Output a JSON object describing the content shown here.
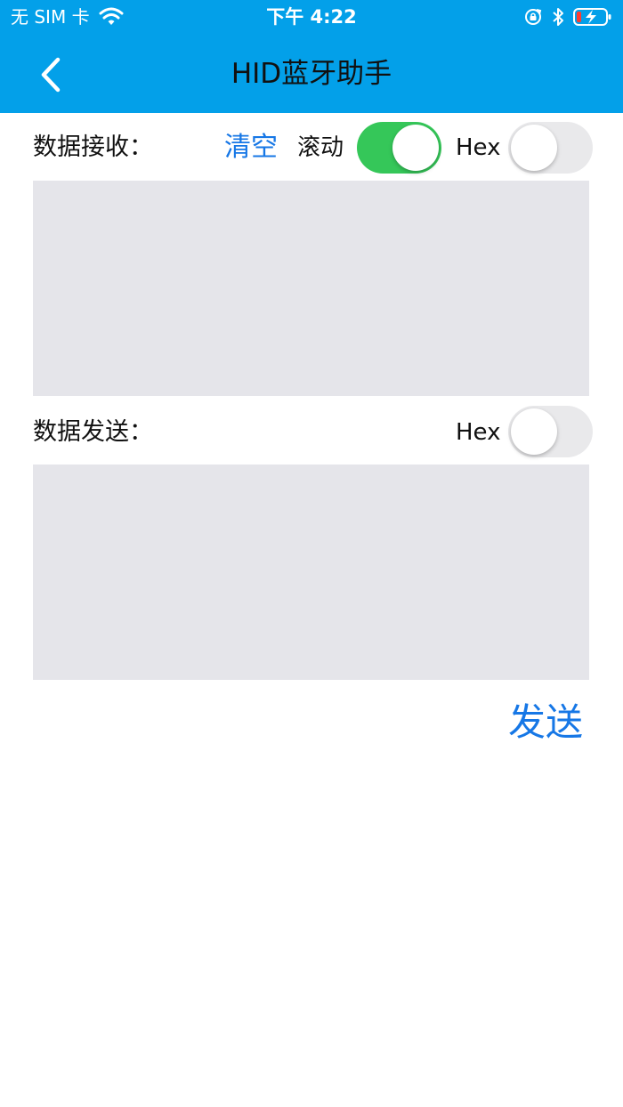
{
  "status_bar": {
    "carrier": "无 SIM 卡",
    "time": "下午 4:22",
    "wifi_icon": "wifi-icon",
    "orientation_icon": "orientation-lock-icon",
    "bluetooth_icon": "bluetooth-icon",
    "battery_icon": "battery-charging-icon"
  },
  "nav": {
    "title": "HID蓝牙助手",
    "back_icon": "chevron-left-icon"
  },
  "receive": {
    "label": "数据接收：",
    "clear_label": "清空",
    "scroll_label": "滚动",
    "scroll_on": true,
    "hex_label": "Hex",
    "hex_on": false,
    "content": ""
  },
  "send": {
    "label": "数据发送：",
    "hex_label": "Hex",
    "hex_on": false,
    "content": "",
    "send_label": "发送"
  },
  "colors": {
    "nav_background": "#03a0e9",
    "accent": "#1677e6",
    "switch_on": "#35c759",
    "switch_off": "#e9e9eb",
    "textarea_background": "#e5e5ea"
  }
}
